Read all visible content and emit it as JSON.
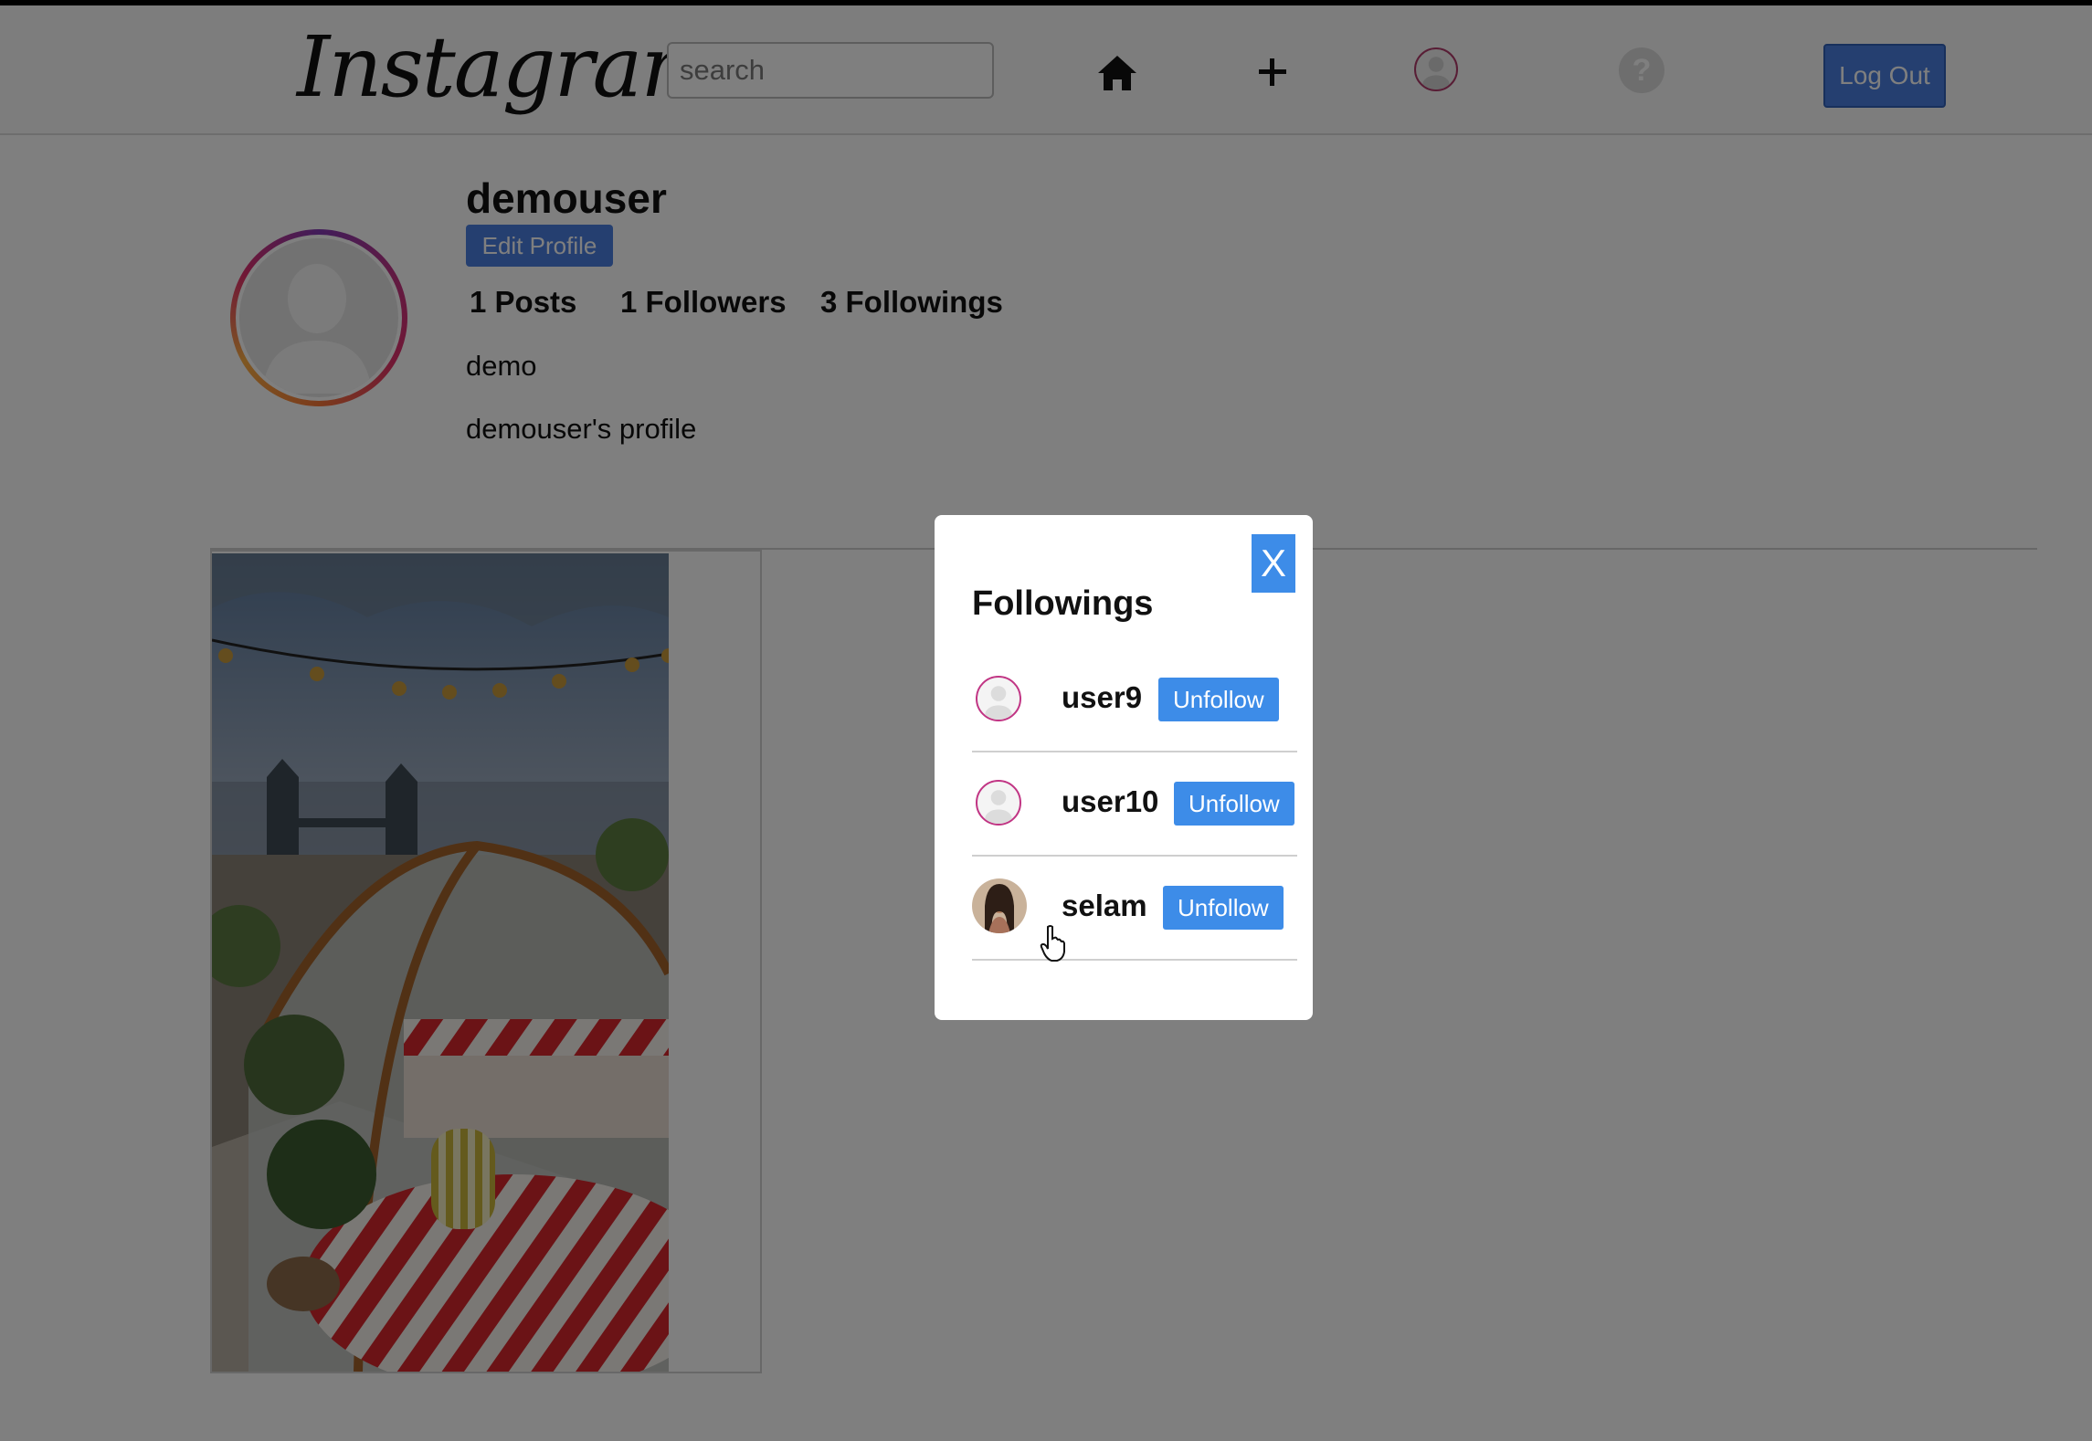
{
  "navbar": {
    "logo": "Instagram",
    "search_placeholder": "search",
    "icons": [
      "home-icon",
      "plus-icon",
      "avatar",
      "help-icon"
    ],
    "help_glyph": "?",
    "logout_label": "Log Out"
  },
  "profile": {
    "username": "demouser",
    "edit_label": "Edit Profile",
    "posts": "1 Posts",
    "followers": "1 Followers",
    "followings": "3 Followings",
    "name": "demo",
    "bio": "demouser's profile"
  },
  "modal": {
    "title": "Followings",
    "close_label": "X",
    "rows": [
      {
        "username": "user9",
        "action": "Unfollow"
      },
      {
        "username": "user10",
        "action": "Unfollow"
      },
      {
        "username": "selam",
        "action": "Unfollow"
      }
    ]
  },
  "colors": {
    "primary_button": "#4a7fe0",
    "modal_button": "#3d8ce8",
    "overlay": "rgba(0,0,0,0.5)"
  }
}
